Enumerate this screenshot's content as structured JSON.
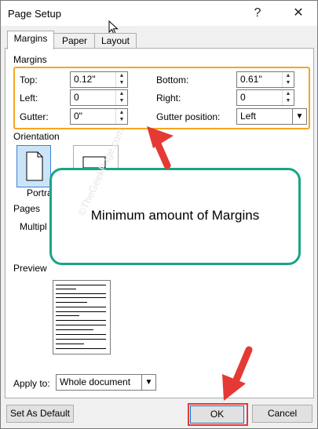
{
  "window": {
    "title": "Page Setup",
    "help_glyph": "?",
    "close_glyph": "✕"
  },
  "tabs": [
    {
      "label": "Margins"
    },
    {
      "label": "Paper"
    },
    {
      "label": "Layout"
    }
  ],
  "margins": {
    "section_label": "Margins",
    "top": {
      "label": "Top:",
      "value": "0.12\""
    },
    "bottom": {
      "label": "Bottom:",
      "value": "0.61\""
    },
    "left": {
      "label": "Left:",
      "value": "0"
    },
    "right": {
      "label": "Right:",
      "value": "0"
    },
    "gutter": {
      "label": "Gutter:",
      "value": "0\""
    },
    "gutter_position": {
      "label": "Gutter position:",
      "value": "Left"
    }
  },
  "orientation": {
    "section_label": "Orientation",
    "portrait_label": "Portra"
  },
  "pages": {
    "section_label": "Pages",
    "multiple_label": "Multipl"
  },
  "preview": {
    "section_label": "Preview"
  },
  "apply_to": {
    "label": "Apply to:",
    "value": "Whole document"
  },
  "buttons": {
    "default": "Set As Default",
    "ok": "OK",
    "cancel": "Cancel"
  },
  "callout": {
    "text": "Minimum amount of Margins"
  },
  "watermark": {
    "text": "©TheGeekPage.com"
  },
  "colors": {
    "highlight_orange": "#f5a623",
    "arrow_red": "#e53935",
    "callout_teal": "#1aa488"
  }
}
